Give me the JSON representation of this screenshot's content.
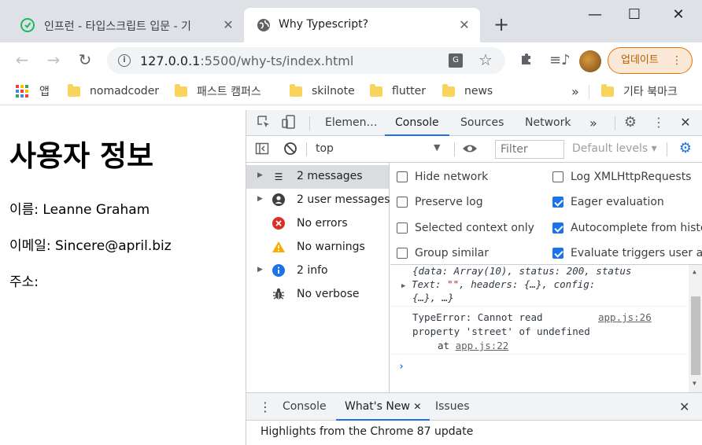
{
  "browser": {
    "tabs": [
      {
        "title": "인프런 - 타입스크립트 입문 - 기",
        "close": "✕"
      },
      {
        "title": "Why Typescript?",
        "close": "✕"
      }
    ],
    "new_tab": "+",
    "window_controls": {
      "minimize": "—",
      "maximize": "☐",
      "close": "✕"
    },
    "address": {
      "host": "127.0.0.1",
      "path": ":5500/why-ts/index.html"
    },
    "update_button": "업데이트",
    "update_menu": "⋮",
    "bookmarks": {
      "apps": "앱",
      "items": [
        "nomadcoder",
        "패스트 캠퍼스",
        "skilnote",
        "flutter",
        "news"
      ],
      "overflow": "»",
      "other": "기타 북마크"
    }
  },
  "page": {
    "heading": "사용자 정보",
    "name_line": "이름: Leanne Graham",
    "email_line": "이메일: Sincere@april.biz",
    "address_line": "주소:"
  },
  "devtools": {
    "tabs": [
      "Elemen…",
      "Console",
      "Sources",
      "Network"
    ],
    "active_tab": "Console",
    "more_tabs": "»",
    "context": "top",
    "filter_placeholder": "Filter",
    "levels": "Default levels ▾",
    "sidebar": [
      {
        "label": "2 messages",
        "icon": "list-icon",
        "expandable": true,
        "selected": true
      },
      {
        "label": "2 user messages",
        "icon": "user-icon",
        "expandable": true,
        "selected": false
      },
      {
        "label": "No errors",
        "icon": "error-icon",
        "expandable": false,
        "selected": false
      },
      {
        "label": "No warnings",
        "icon": "warning-icon",
        "expandable": false,
        "selected": false
      },
      {
        "label": "2 info",
        "icon": "info-icon",
        "expandable": true,
        "selected": false
      },
      {
        "label": "No verbose",
        "icon": "bug-icon",
        "expandable": false,
        "selected": false
      }
    ],
    "settings": [
      {
        "label": "Hide network",
        "checked": false
      },
      {
        "label": "Log XMLHttpRequests",
        "checked": false
      },
      {
        "label": "Preserve log",
        "checked": false
      },
      {
        "label": "Eager evaluation",
        "checked": true
      },
      {
        "label": "Selected context only",
        "checked": false
      },
      {
        "label": "Autocomplete from history",
        "checked": true
      },
      {
        "label": "Group similar",
        "checked": false
      },
      {
        "label": "Evaluate triggers user activation",
        "checked": true
      }
    ],
    "console": {
      "obj_line1": "{data: Array(10), status: 200, status",
      "obj_line2_a": "Text: ",
      "obj_line2_str": "\"\"",
      "obj_line2_b": ", headers: {…}, config:",
      "obj_line3": "{…}, …}",
      "error_line1": "TypeError: Cannot read",
      "error_source": "app.js:26",
      "error_line2": "property 'street' of undefined",
      "error_line3_prefix": "at ",
      "error_line3_link": "app.js:22",
      "prompt": "›"
    },
    "drawer": {
      "tabs": [
        "Console",
        "What's New",
        "Issues"
      ],
      "active_tab": "What's New",
      "highlights": "Highlights from the Chrome 87 update"
    }
  }
}
